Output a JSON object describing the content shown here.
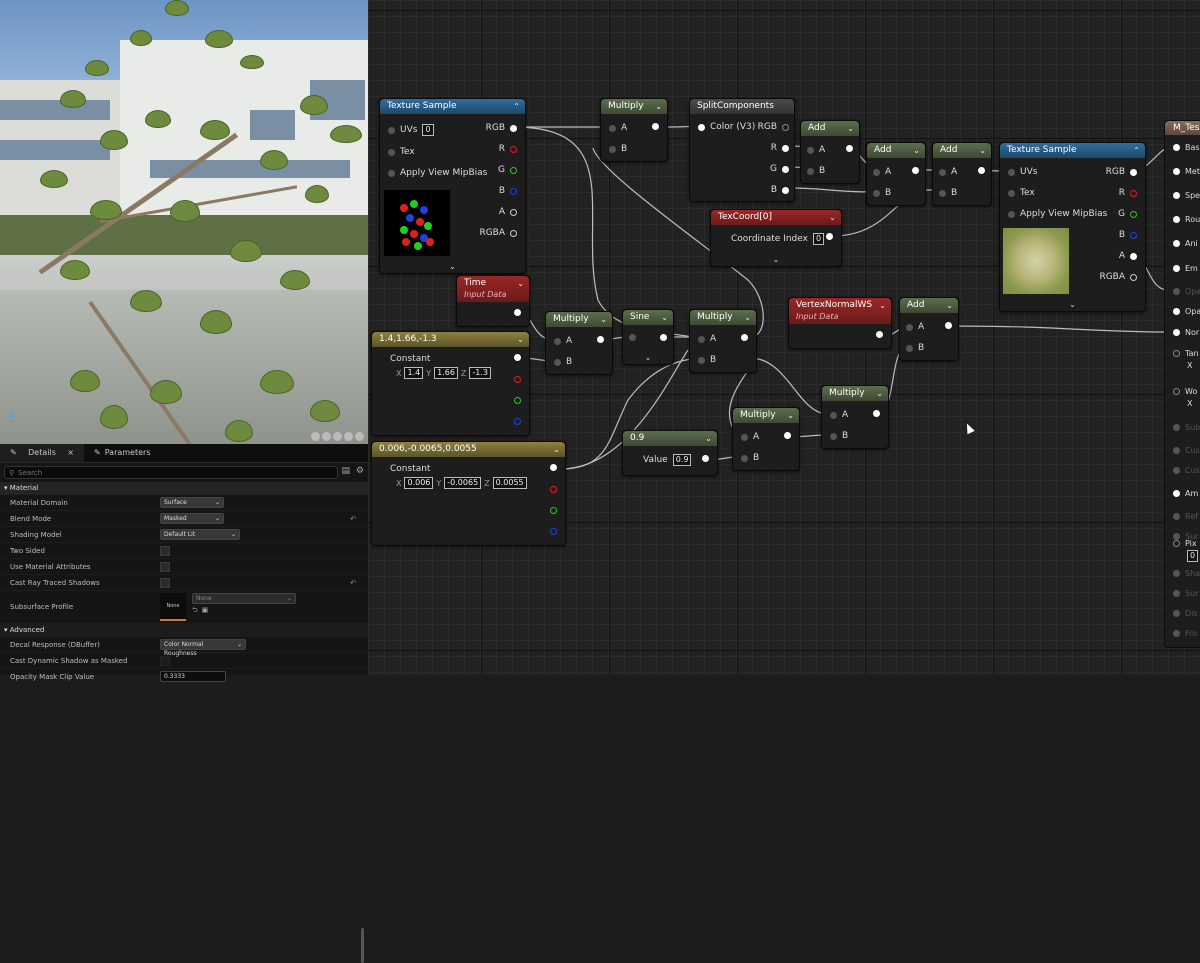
{
  "details": {
    "tab_details": "Details",
    "tab_parameters": "Parameters",
    "search_placeholder": "Search",
    "section_material": "Material",
    "section_advanced": "Advanced",
    "rows": {
      "material_domain": {
        "label": "Material Domain",
        "value": "Surface"
      },
      "blend_mode": {
        "label": "Blend Mode",
        "value": "Masked"
      },
      "shading_model": {
        "label": "Shading Model",
        "value": "Default Lit"
      },
      "two_sided": {
        "label": "Two Sided"
      },
      "use_material_attributes": {
        "label": "Use Material Attributes"
      },
      "cast_ray_traced_shadows": {
        "label": "Cast Ray Traced Shadows"
      },
      "subsurface_profile": {
        "label": "Subsurface Profile",
        "thumb": "None",
        "value": "None"
      },
      "decal_response": {
        "label": "Decal Response (DBuffer)",
        "value": "Color Normal Roughness"
      },
      "cast_dynamic_shadow": {
        "label": "Cast Dynamic Shadow as Masked"
      },
      "opacity_mask_clip": {
        "label": "Opacity Mask Clip Value",
        "value": "0.3333"
      }
    }
  },
  "nodes": {
    "tex1": {
      "title": "Texture Sample",
      "uvs": "UVs",
      "uvs_val": "0",
      "tex": "Tex",
      "mip": "Apply View MipBias",
      "rgb": "RGB",
      "r": "R",
      "g": "G",
      "b": "B",
      "a": "A",
      "rgba": "RGBA"
    },
    "mul1": {
      "title": "Multiply",
      "a": "A",
      "b": "B"
    },
    "split": {
      "title": "SplitComponents",
      "in": "Color (V3)",
      "rgb": "RGB",
      "r": "R",
      "g": "G",
      "b": "B"
    },
    "add1": {
      "title": "Add",
      "a": "A",
      "b": "B"
    },
    "add2": {
      "title": "Add",
      "a": "A",
      "b": "B"
    },
    "add3": {
      "title": "Add",
      "a": "A",
      "b": "B"
    },
    "tex2": {
      "title": "Texture Sample",
      "uvs": "UVs",
      "tex": "Tex",
      "mip": "Apply View MipBias",
      "rgb": "RGB",
      "r": "R",
      "g": "G",
      "b": "B",
      "a": "A",
      "rgba": "RGBA"
    },
    "texcoord": {
      "title": "TexCoord[0]",
      "label": "Coordinate Index",
      "val": "0"
    },
    "time": {
      "title": "Time",
      "sub": "Input Data"
    },
    "const1": {
      "title": "1.4,1.66,-1.3",
      "label": "Constant",
      "x": "1.4",
      "y": "1.66",
      "z": "-1.3"
    },
    "mul2": {
      "title": "Multiply",
      "a": "A",
      "b": "B"
    },
    "sine": {
      "title": "Sine"
    },
    "mul3": {
      "title": "Multiply",
      "a": "A",
      "b": "B"
    },
    "vnormal": {
      "title": "VertexNormalWS",
      "sub": "Input Data"
    },
    "add4": {
      "title": "Add",
      "a": "A",
      "b": "B"
    },
    "const2": {
      "title": "0.006,-0.0065,0.0055",
      "label": "Constant",
      "x": "0.006",
      "y": "-0.0065",
      "z": "0.0055"
    },
    "scalar": {
      "title": "0.9",
      "label": "Value",
      "val": "0.9"
    },
    "mul4": {
      "title": "Multiply",
      "a": "A",
      "b": "B"
    },
    "mul5": {
      "title": "Multiply",
      "a": "A",
      "b": "B"
    }
  },
  "result": {
    "title": "M_Tes",
    "pins": [
      "Bas",
      "Met",
      "Spe",
      "Rou",
      "Ani",
      "Em",
      "Opa",
      "Opa",
      "Nor",
      "Tan",
      "Wo",
      "Sub",
      "Cus",
      "Cus",
      "Am",
      "Ref",
      "Sur",
      "Pix",
      "Sha",
      "Sur",
      "Dis",
      "Fro"
    ],
    "tan_x": "X",
    "wo_x": "X",
    "pix_val": "0"
  },
  "colors": {
    "graph_bg": "#222222",
    "accent_blue": "#2f6ea0",
    "accent_green": "#5c6e4c",
    "accent_red": "#9b2828",
    "accent_gold": "#8d8040"
  }
}
